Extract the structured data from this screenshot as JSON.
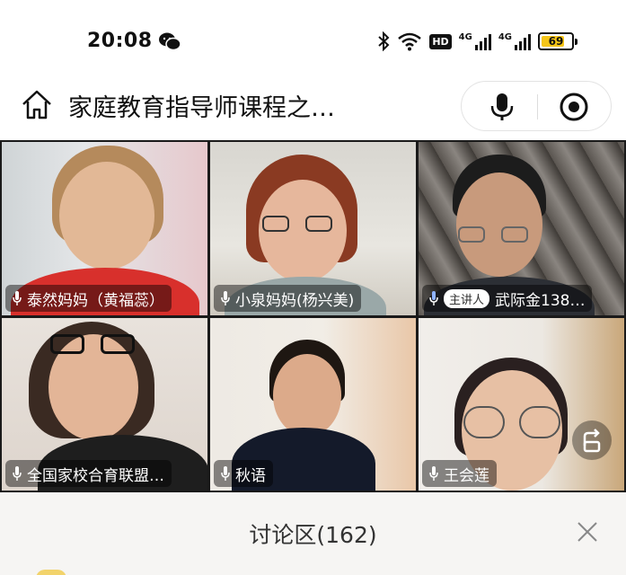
{
  "status_bar": {
    "time": "20:08",
    "network_badge": "HD",
    "signal1_label": "4G",
    "signal2_label": "4G",
    "battery_level": "69",
    "icons": [
      "wechat-icon",
      "bluetooth-icon",
      "wifi-icon",
      "signal-icon",
      "battery-icon"
    ]
  },
  "header": {
    "title": "家庭教育指导师课程之…",
    "icons": [
      "home-icon",
      "microphone-icon",
      "record-icon"
    ]
  },
  "participants": [
    {
      "name": "泰然妈妈（黄福蕊）",
      "host": false
    },
    {
      "name": "小泉妈妈(杨兴美)",
      "host": false
    },
    {
      "name": "武际金138…",
      "host": true,
      "host_label": "主讲人"
    },
    {
      "name": "全国家校合育联盟…",
      "host": false
    },
    {
      "name": "秋语",
      "host": false
    },
    {
      "name": "王会莲",
      "host": false
    }
  ],
  "discussion": {
    "title": "讨论区(162)"
  },
  "colors": {
    "accent_battery": "#f5c518",
    "discussion_bg": "#f6f5f3"
  }
}
